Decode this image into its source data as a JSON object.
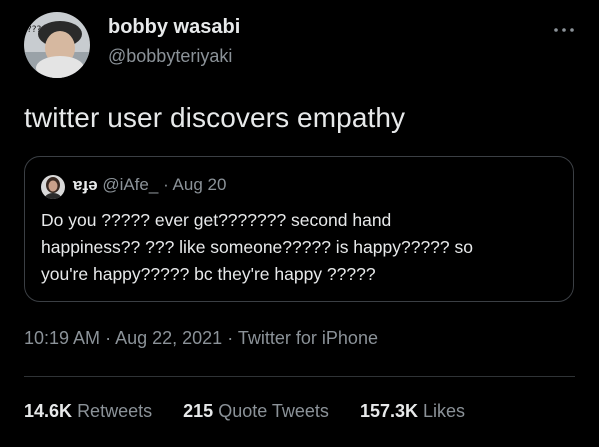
{
  "tweet": {
    "display_name": "bobby wasabi",
    "handle": "@bobbyteriyaki",
    "text": "twitter user discovers empathy",
    "more_icon": "more-horizontal-icon",
    "avatar_icon": "profile-photo",
    "avatar_overlay_text": "???"
  },
  "quote": {
    "display_name": "ɐɟə",
    "handle": "@iAfe_",
    "separator": "·",
    "date": "Aug 20",
    "lines": [
      "Do you ????? ever get??????? second hand",
      "happiness?? ??? like someone????? is happy????? so",
      "you're happy????? bc they're happy ?????"
    ]
  },
  "meta": {
    "time": "10:19 AM",
    "separator": "·",
    "date": "Aug 22, 2021",
    "source": "Twitter for iPhone"
  },
  "stats": {
    "retweets_count": "14.6K",
    "retweets_label": "Retweets",
    "quotes_count": "215",
    "quotes_label": "Quote Tweets",
    "likes_count": "157.3K",
    "likes_label": "Likes"
  },
  "colors": {
    "background": "#000000",
    "primary_text": "#e7e9ea",
    "secondary_text": "#8b9298",
    "border": "#3b3f44"
  }
}
